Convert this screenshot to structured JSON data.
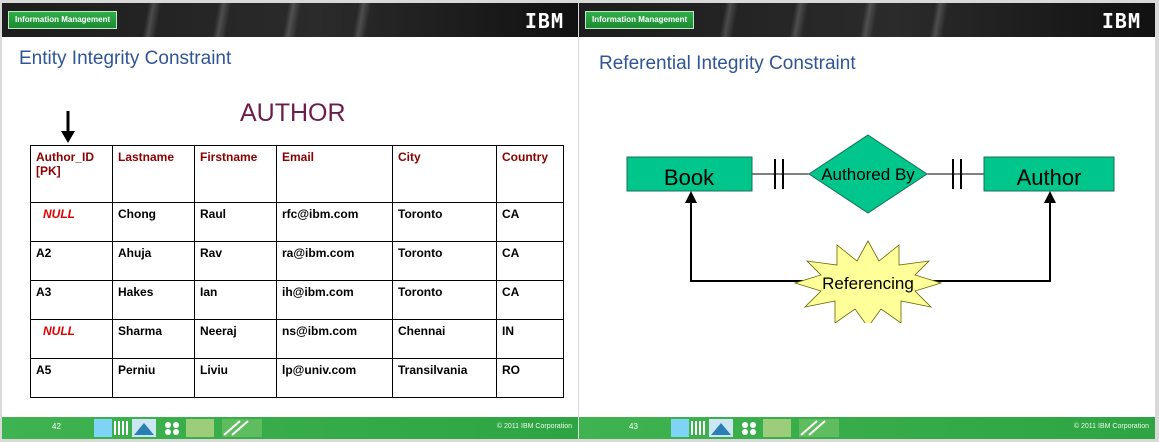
{
  "left_slide": {
    "header_badge": "Information Management",
    "logo": "IBM",
    "title": "Entity Integrity Constraint",
    "table_title": "AUTHOR",
    "columns": [
      "Author_ID\n[PK]",
      "Lastname",
      "Firstname",
      "Email",
      "City",
      "Country"
    ],
    "rows": [
      [
        "NULL",
        "Chong",
        "Raul",
        "rfc@ibm.com",
        "Toronto",
        "CA"
      ],
      [
        "A2",
        "Ahuja",
        "Rav",
        "ra@ibm.com",
        "Toronto",
        "CA"
      ],
      [
        "A3",
        "Hakes",
        "Ian",
        "ih@ibm.com",
        "Toronto",
        "CA"
      ],
      [
        "NULL",
        "Sharma",
        "Neeraj",
        "ns@ibm.com",
        "Chennai",
        "IN"
      ],
      [
        "A5",
        "Perniu",
        "Liviu",
        "lp@univ.com",
        "Transilvania",
        "RO"
      ]
    ],
    "page_number": "42",
    "copyright": "© 2011 IBM Corporation"
  },
  "right_slide": {
    "header_badge": "Information Management",
    "logo": "IBM",
    "title": "Referential Integrity Constraint",
    "entity_left": "Book",
    "relationship": "Authored By",
    "entity_right": "Author",
    "burst_label": "Referencing",
    "page_number": "43",
    "copyright": "© 2011 IBM Corporation"
  },
  "colors": {
    "title_blue": "#2f5597",
    "table_title": "#6b1e4a",
    "header_red": "#8b0000",
    "null_red": "#e00000",
    "entity_green": "#00c68c",
    "burst_yellow": "#ffff99",
    "footer_green": "#3fb34f"
  }
}
